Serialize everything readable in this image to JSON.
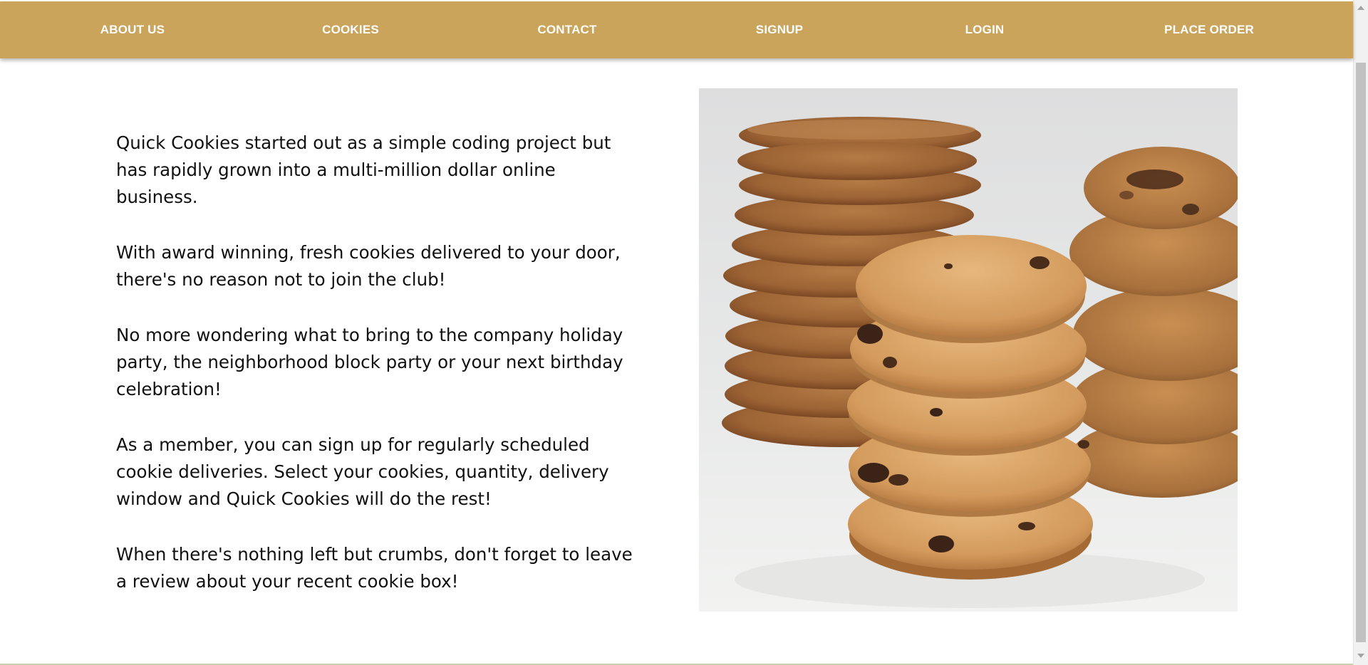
{
  "nav": {
    "about": "ABOUT US",
    "cookies": "COOKIES",
    "contact": "CONTACT",
    "signup": "SIGNUP",
    "login": "LOGIN",
    "place_order": "PLACE ORDER"
  },
  "about": {
    "paragraphs": [
      "Quick Cookies started out as a simple coding project but has rapidly grown into a multi-million dollar online business.",
      "With award winning, fresh cookies delivered to your door, there's no reason not to join the club!",
      "No more wondering what to bring to the company holiday party, the neighborhood block party or your next birthday celebration!",
      "As a member, you can sign up for regularly scheduled cookie deliveries. Select your cookies, quantity, delivery window and Quick Cookies will do the rest!",
      "When there's nothing left but crumbs, don't forget to leave a review about your recent cookie box!"
    ]
  },
  "colors": {
    "nav_background": "#c9a45a",
    "nav_text": "#ffffff",
    "body_text": "#111111",
    "page_background": "#ffffff"
  }
}
